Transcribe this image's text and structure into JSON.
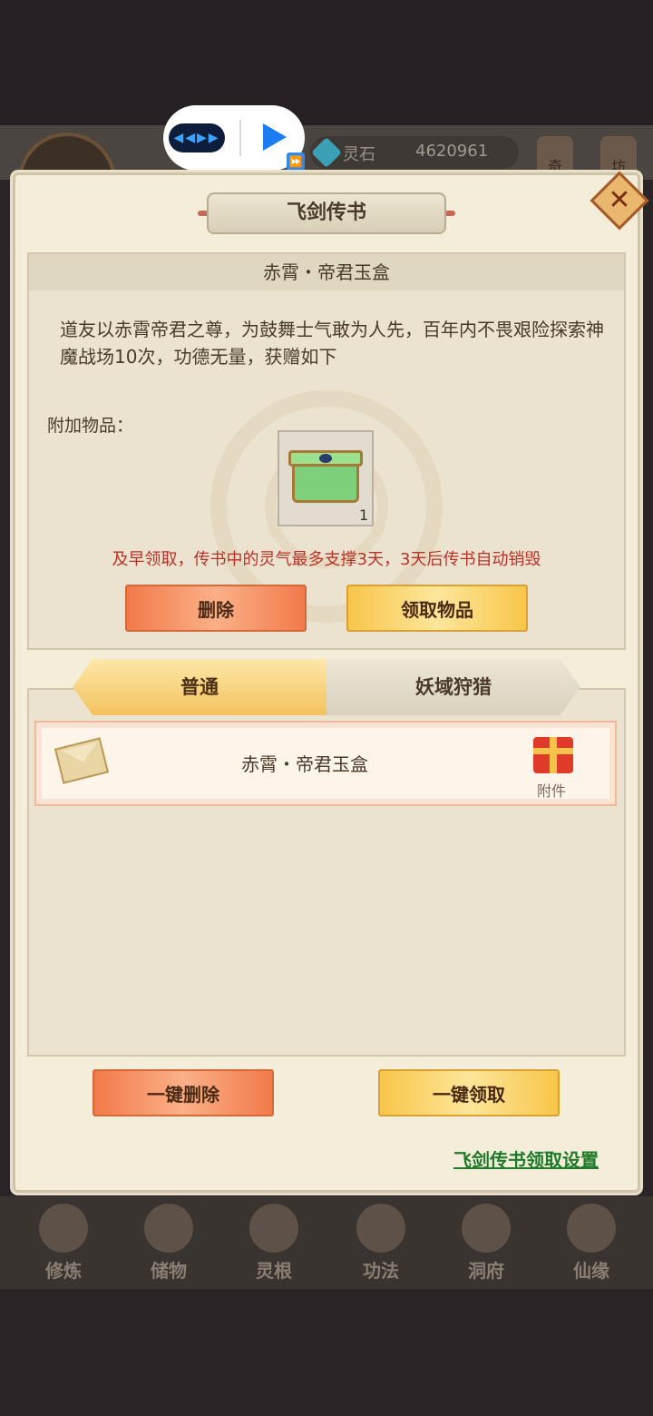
{
  "ad": {
    "logo_text": "◀◀▶▶",
    "play_icon": "play-icon",
    "ff_icon": "⏩"
  },
  "header": {
    "stone_label": "灵石",
    "stone_value": "4620961",
    "lantern_left": "奇",
    "lantern_right": "坊"
  },
  "dialog": {
    "title": "飞剑传书",
    "close_icon": "✕",
    "mail": {
      "title": "赤霄・帝君玉盒",
      "body": "道友以赤霄帝君之尊，为鼓舞士气敢为人先，百年内不畏艰险探索神魔战场10次，功德无量，获赠如下",
      "attach_label": "附加物品：",
      "item_count": "1",
      "warning": "及早领取，传书中的灵气最多支撑3天，3天后传书自动销毁",
      "delete_label": "删除",
      "claim_label": "领取物品"
    },
    "tabs": [
      {
        "label": "普通",
        "active": true
      },
      {
        "label": "妖域狩猎",
        "active": false
      }
    ],
    "list": [
      {
        "title": "赤霄・帝君玉盒",
        "attach_label": "附件"
      }
    ],
    "delete_all_label": "一键删除",
    "claim_all_label": "一键领取",
    "settings_link": "飞剑传书领取设置"
  },
  "nav": {
    "items": [
      {
        "label": "修炼"
      },
      {
        "label": "储物"
      },
      {
        "label": "灵根"
      },
      {
        "label": "功法"
      },
      {
        "label": "洞府"
      },
      {
        "label": "仙缘"
      }
    ]
  },
  "colors": {
    "panel_bg": "#f3edda",
    "warning_red": "#b83228",
    "link_green": "#1f7a2a",
    "button_red": "#f27a4a",
    "button_gold": "#f8c64a"
  }
}
